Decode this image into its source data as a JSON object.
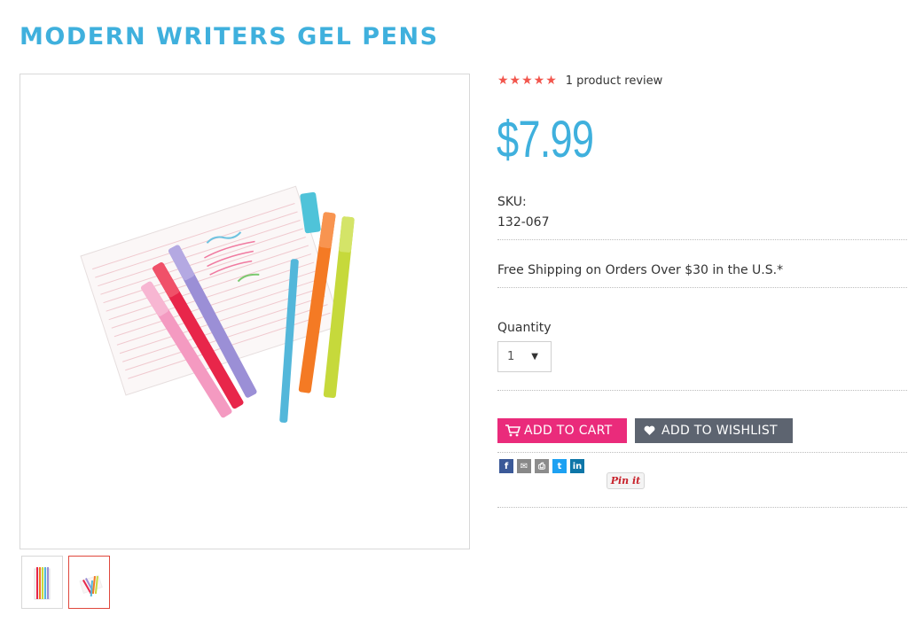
{
  "product": {
    "title": "MODERN WRITERS GEL PENS",
    "rating_stars": "★★★★★",
    "rating_value": 5,
    "review_link": "1 product review",
    "price": "$7.99",
    "sku_label": "SKU:",
    "sku_value": "132-067",
    "shipping_note": "Free Shipping on Orders Over $30 in the U.S.*"
  },
  "quantity": {
    "label": "Quantity",
    "selected": "1",
    "caret": "▼"
  },
  "actions": {
    "add_to_cart": "ADD TO CART",
    "add_to_wishlist": "ADD TO WISHLIST"
  },
  "share": {
    "icons": [
      "facebook-icon",
      "email-icon",
      "print-icon",
      "twitter-icon",
      "linkedin-icon"
    ],
    "facebook_glyph": "f",
    "email_glyph": "✉",
    "print_glyph": "⎙",
    "twitter_glyph": "t",
    "linkedin_glyph": "in",
    "pin_label": "Pin it"
  },
  "gallery": {
    "thumbnail_count": 2,
    "selected_thumbnail": 2
  },
  "colors": {
    "title": "#3fb0dd",
    "price": "#3fb0dd",
    "stars": "#f2564d",
    "add_to_cart_bg": "#ea2b7b",
    "wishlist_bg": "#5d6470",
    "selected_thumb_border": "#e0473c"
  }
}
